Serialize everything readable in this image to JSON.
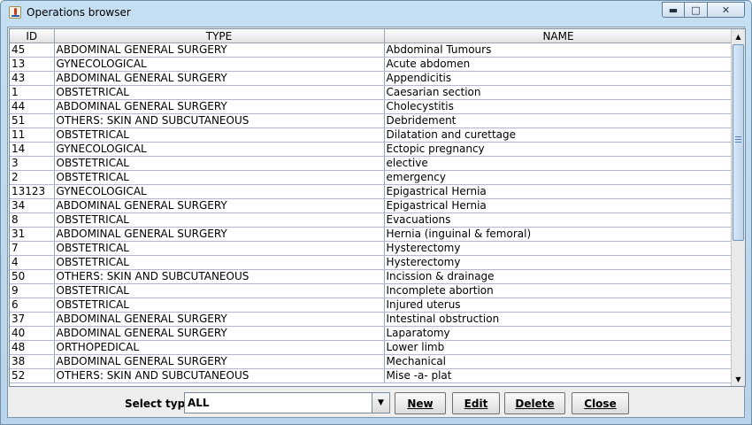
{
  "window": {
    "title": "Operations browser"
  },
  "table": {
    "columns": [
      "ID",
      "TYPE",
      "NAME"
    ],
    "rows": [
      [
        "45",
        "ABDOMINAL GENERAL SURGERY",
        "Abdominal Tumours"
      ],
      [
        "13",
        "GYNECOLOGICAL",
        "Acute abdomen"
      ],
      [
        "43",
        "ABDOMINAL GENERAL SURGERY",
        "Appendicitis"
      ],
      [
        "1",
        "OBSTETRICAL",
        "Caesarian section"
      ],
      [
        "44",
        "ABDOMINAL GENERAL SURGERY",
        "Cholecystitis"
      ],
      [
        "51",
        "OTHERS: SKIN AND SUBCUTANEOUS",
        "Debridement"
      ],
      [
        "11",
        "OBSTETRICAL",
        "Dilatation and curettage"
      ],
      [
        "14",
        "GYNECOLOGICAL",
        "Ectopic pregnancy"
      ],
      [
        "3",
        "OBSTETRICAL",
        "elective"
      ],
      [
        "2",
        "OBSTETRICAL",
        "emergency"
      ],
      [
        "13123",
        "GYNECOLOGICAL",
        "Epigastrical Hernia"
      ],
      [
        "34",
        "ABDOMINAL GENERAL SURGERY",
        "Epigastrical Hernia"
      ],
      [
        "8",
        "OBSTETRICAL",
        "Evacuations"
      ],
      [
        "31",
        "ABDOMINAL GENERAL SURGERY",
        "Hernia (inguinal & femoral)"
      ],
      [
        "7",
        "OBSTETRICAL",
        "Hysterectomy"
      ],
      [
        "4",
        "OBSTETRICAL",
        "Hysterectomy"
      ],
      [
        "50",
        "OTHERS: SKIN AND SUBCUTANEOUS",
        "Incission & drainage"
      ],
      [
        "9",
        "OBSTETRICAL",
        "Incomplete abortion"
      ],
      [
        "6",
        "OBSTETRICAL",
        "Injured uterus"
      ],
      [
        "37",
        "ABDOMINAL GENERAL SURGERY",
        "Intestinal obstruction"
      ],
      [
        "40",
        "ABDOMINAL GENERAL SURGERY",
        "Laparatomy"
      ],
      [
        "48",
        "ORTHOPEDICAL",
        "Lower limb"
      ],
      [
        "38",
        "ABDOMINAL GENERAL SURGERY",
        "Mechanical"
      ],
      [
        "52",
        "OTHERS: SKIN AND SUBCUTANEOUS",
        "Mise -a- plat"
      ]
    ]
  },
  "filter": {
    "label": "Select type",
    "selected": "ALL"
  },
  "buttons": {
    "new": "New",
    "edit": "Edit",
    "delete": "Delete",
    "close": "Close"
  },
  "icons": {
    "window": "java-cup-icon",
    "minimize": "minimize-icon",
    "maximize": "maximize-icon",
    "close": "close-icon"
  }
}
